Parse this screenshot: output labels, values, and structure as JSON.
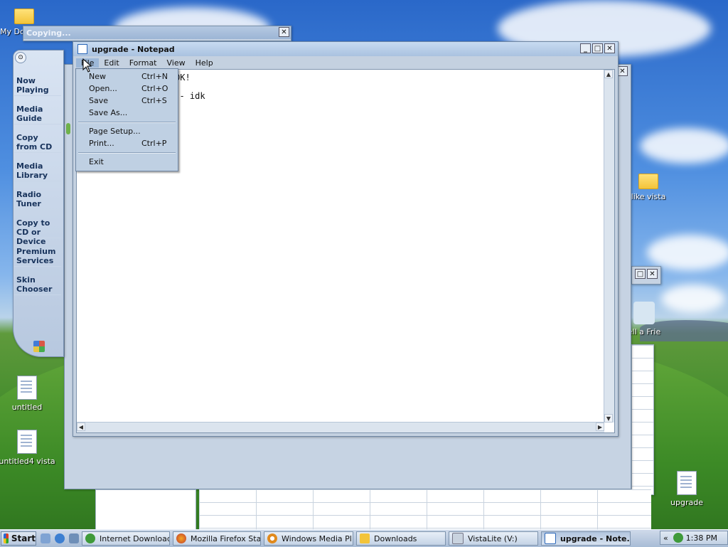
{
  "desktop": {
    "icons": [
      {
        "label": "My Do"
      },
      {
        "label": "like vista"
      },
      {
        "label": "ell a Frie"
      },
      {
        "label": "untitled"
      },
      {
        "label": "untitled4 vista"
      },
      {
        "label": "upgrade"
      }
    ]
  },
  "copying_window": {
    "title": "Copying..."
  },
  "wmp": {
    "nav": [
      "Now Playing",
      "Media Guide",
      "Copy from CD",
      "Media Library",
      "Radio Tuner",
      "Copy to CD or Device",
      "Premium Services",
      "Skin Chooser"
    ]
  },
  "notepad": {
    "title": "upgrade - Notepad",
    "menus": [
      "File",
      "Edit",
      "Format",
      "View",
      "Help"
    ],
    "text_line1": "OK!",
    "text_line2": "e - idk"
  },
  "file_menu": {
    "items": [
      {
        "label": "New",
        "shortcut": "Ctrl+N"
      },
      {
        "label": "Open...",
        "shortcut": "Ctrl+O"
      },
      {
        "label": "Save",
        "shortcut": "Ctrl+S"
      },
      {
        "label": "Save As...",
        "shortcut": ""
      },
      {
        "label": "Page Setup...",
        "shortcut": ""
      },
      {
        "label": "Print...",
        "shortcut": "Ctrl+P"
      },
      {
        "label": "Exit",
        "shortcut": ""
      }
    ]
  },
  "taskbar": {
    "start": "Start",
    "tasks": [
      "Internet Download ...",
      "Mozilla Firefox Star...",
      "Windows Media Pl...",
      "Downloads",
      "VistaLite (V:)",
      "upgrade - Note..."
    ],
    "clock": "1:38 PM",
    "tray_chevron": "«"
  },
  "colors": {
    "accent": "#2569d6",
    "chrome": "#c6d3e3"
  }
}
